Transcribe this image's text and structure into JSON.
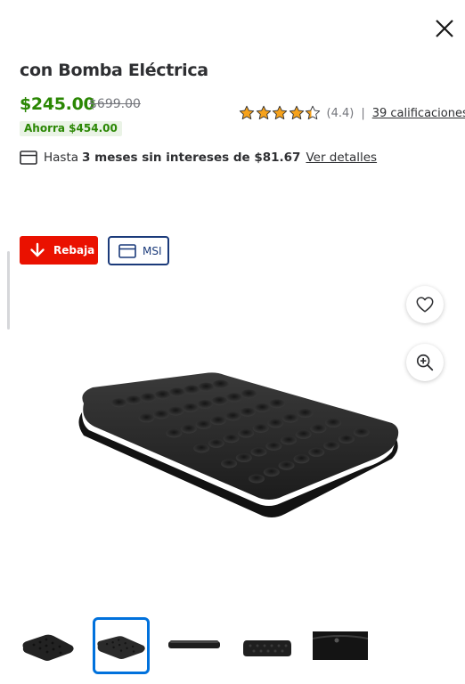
{
  "header": {
    "close_icon": "close-icon"
  },
  "product": {
    "title": "con Bomba Eléctrica",
    "price": "$245.00",
    "old_price": "$699.00",
    "savings": "Ahorra $454.00",
    "rating": {
      "stars": 4.4,
      "value_text": "(4.4)",
      "separator": "|",
      "reviews_link": "39 calificaciones"
    },
    "installments": {
      "prefix": "Hasta",
      "bold": "3 meses sin intereses de $81.67",
      "link": "Ver detalles",
      "icon": "credit-card-icon"
    }
  },
  "badges": {
    "sale": {
      "label": "Rebaja",
      "icon": "arrow-down-icon",
      "color": "#ea1100"
    },
    "msi": {
      "label": "MSI",
      "icon": "credit-card-icon",
      "color": "#1a3a7a"
    }
  },
  "actions": {
    "favorite_icon": "heart-icon",
    "zoom_icon": "zoom-in-icon"
  },
  "gallery": {
    "selected_index": 1,
    "thumbnails": [
      "thumb-mattress-top",
      "thumb-mattress-angle",
      "thumb-mattress-side",
      "thumb-mattress-front",
      "thumb-mattress-detail"
    ]
  },
  "colors": {
    "price_green": "#2a8703",
    "accent_blue": "#0071dc",
    "star_gold": "#f6a21c"
  }
}
